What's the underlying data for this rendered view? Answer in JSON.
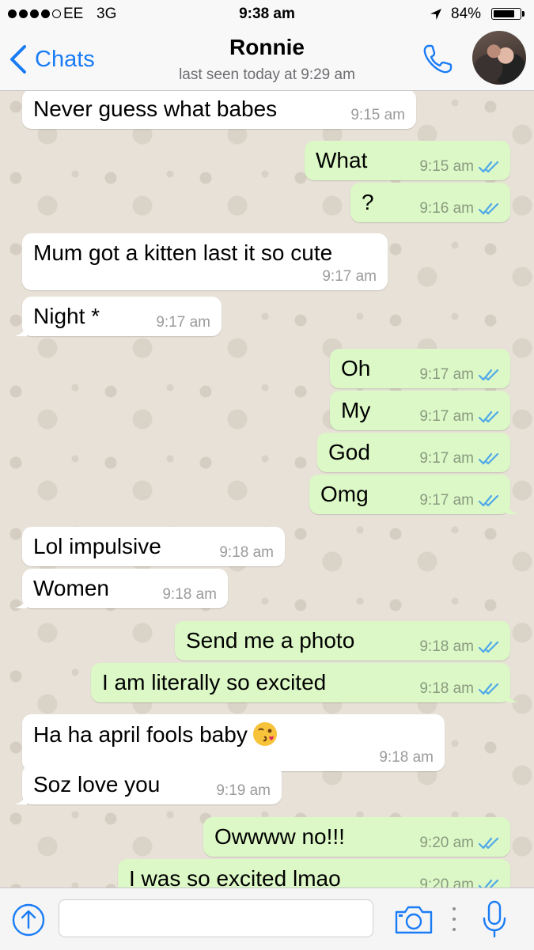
{
  "status_bar": {
    "carrier": "EE",
    "network": "3G",
    "time": "9:38 am",
    "battery": "84%",
    "battery_level": 0.84
  },
  "header": {
    "back_label": "Chats",
    "contact_name": "Ronnie",
    "last_seen": "last seen today at 9:29 am",
    "icons": [
      "chevron-left-icon",
      "phone-icon",
      "avatar"
    ]
  },
  "messages": [
    {
      "dir": "in",
      "text": "Never guess what babes",
      "time": "9:15 am"
    },
    {
      "dir": "out",
      "text": "What",
      "time": "9:15 am",
      "read": true
    },
    {
      "dir": "out",
      "text": "?",
      "time": "9:16 am",
      "read": true
    },
    {
      "dir": "in",
      "text": "Mum got a kitten last it so cute",
      "time": "9:17 am"
    },
    {
      "dir": "in",
      "text": "Night *",
      "time": "9:17 am"
    },
    {
      "dir": "out",
      "text": "Oh",
      "time": "9:17 am",
      "read": true
    },
    {
      "dir": "out",
      "text": "My",
      "time": "9:17 am",
      "read": true
    },
    {
      "dir": "out",
      "text": "God",
      "time": "9:17 am",
      "read": true
    },
    {
      "dir": "out",
      "text": "Omg",
      "time": "9:17 am",
      "read": true
    },
    {
      "dir": "in",
      "text": "Lol impulsive",
      "time": "9:18 am"
    },
    {
      "dir": "in",
      "text": "Women",
      "time": "9:18 am"
    },
    {
      "dir": "out",
      "text": "Send me a photo",
      "time": "9:18 am",
      "read": true
    },
    {
      "dir": "out",
      "text": "I am literally so excited",
      "time": "9:18 am",
      "read": true
    },
    {
      "dir": "in",
      "text": "Ha ha april fools baby",
      "time": "9:18 am",
      "emoji": "face-throwing-kiss"
    },
    {
      "dir": "in",
      "text": "Soz love you",
      "time": "9:19 am"
    },
    {
      "dir": "out",
      "text": "Owwww no!!!",
      "time": "9:20 am",
      "read": true
    },
    {
      "dir": "out",
      "text": "I was so excited lmao",
      "time": "9:20 am",
      "read": true
    }
  ],
  "input_bar": {
    "placeholder": "",
    "icons": [
      "upload-arrow-icon",
      "camera-icon",
      "more-dots-icon",
      "microphone-icon"
    ]
  },
  "colors": {
    "accent": "#1a7cf5",
    "incoming_bubble": "#ffffff",
    "outgoing_bubble": "#dcf8c6",
    "read_ticks": "#4fa8e8",
    "wallpaper": "#e7e1d7"
  }
}
